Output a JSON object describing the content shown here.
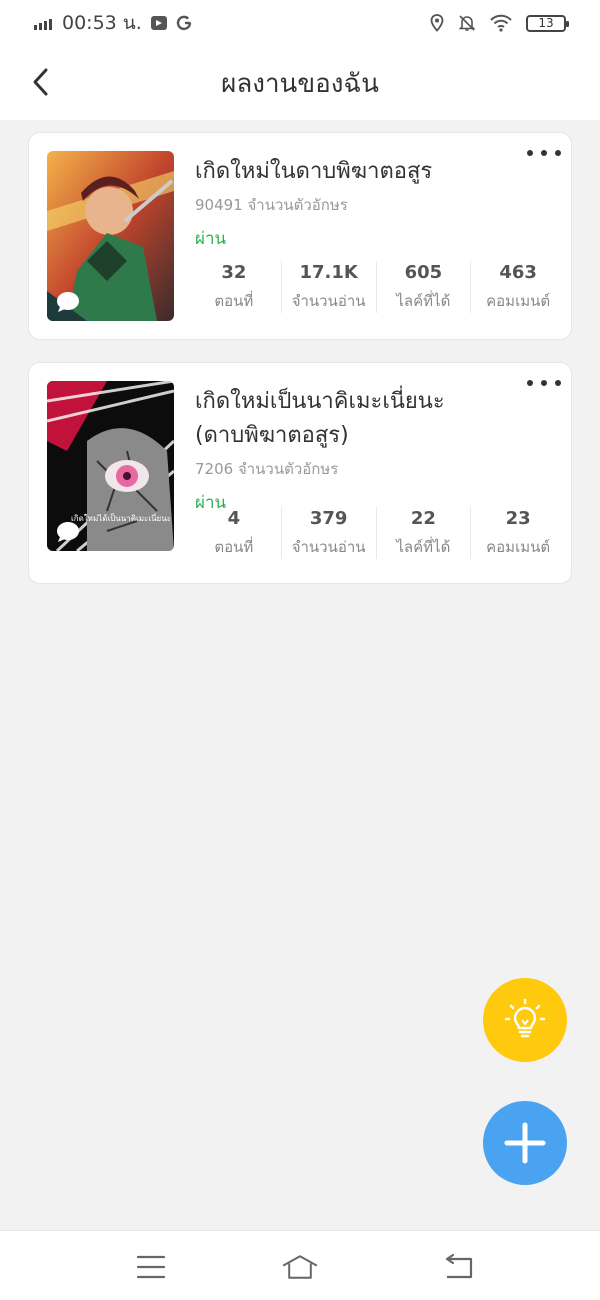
{
  "status_bar": {
    "time": "00:53 น.",
    "battery": "13"
  },
  "header": {
    "title": "ผลงานของฉัน"
  },
  "works": [
    {
      "title": "เกิดใหม่ในดาบพิฆาตอสูร",
      "char_count": "90491 จำนวนตัวอักษร",
      "status": "ผ่าน",
      "stats": [
        {
          "value": "32",
          "label": "ตอนที่"
        },
        {
          "value": "17.1K",
          "label": "จำนวนอ่าน"
        },
        {
          "value": "605",
          "label": "ไลค์ที่ได้"
        },
        {
          "value": "463",
          "label": "คอมเมนต์"
        }
      ]
    },
    {
      "title": "เกิดใหม่เป็นนาคิเมะเนี่ยนะ (ดาบพิฆาตอสูร)",
      "char_count": "7206 จำนวนตัวอักษร",
      "status": "ผ่าน",
      "cover_text": "เกิดใหม่ได้เป็นนาคิเมะเนี่ยนะ",
      "stats": [
        {
          "value": "4",
          "label": "ตอนที่"
        },
        {
          "value": "379",
          "label": "จำนวนอ่าน"
        },
        {
          "value": "22",
          "label": "ไลค์ที่ได้"
        },
        {
          "value": "23",
          "label": "คอมเมนต์"
        }
      ]
    }
  ],
  "icons": {
    "back": "chevron-left-icon",
    "more": "more-horizontal-icon",
    "idea": "lightbulb-icon",
    "add": "plus-icon",
    "nav_menu": "menu-icon",
    "nav_home": "home-icon",
    "nav_back": "return-icon"
  },
  "colors": {
    "status_pass": "#2bb24c",
    "fab_idea": "#ffc90e",
    "fab_add": "#4aa3f0",
    "background": "#f2f2f2"
  }
}
